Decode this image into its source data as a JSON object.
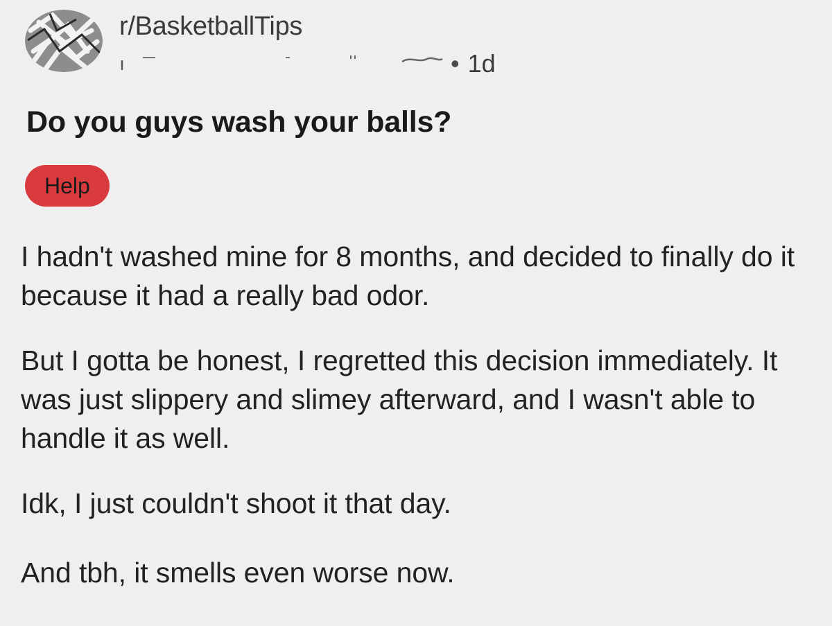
{
  "post": {
    "subreddit": "r/BasketballTips",
    "time": "1d",
    "separator": "•",
    "title": "Do you guys wash your balls?",
    "flair": "Help",
    "paragraphs": [
      "I hadn't washed mine for 8 months, and decided to finally do it because it had a really bad odor.",
      "But I gotta be honest, I regretted this decision immediately. It was just slippery and slimey afterward, and I wasn't able to handle it as well.",
      "Idk, I just couldn't shoot it that day.",
      "And tbh, it smells even worse now."
    ]
  },
  "colors": {
    "background": "#efefef",
    "flair": "#d93a3e",
    "text": "#1c1c1c"
  }
}
